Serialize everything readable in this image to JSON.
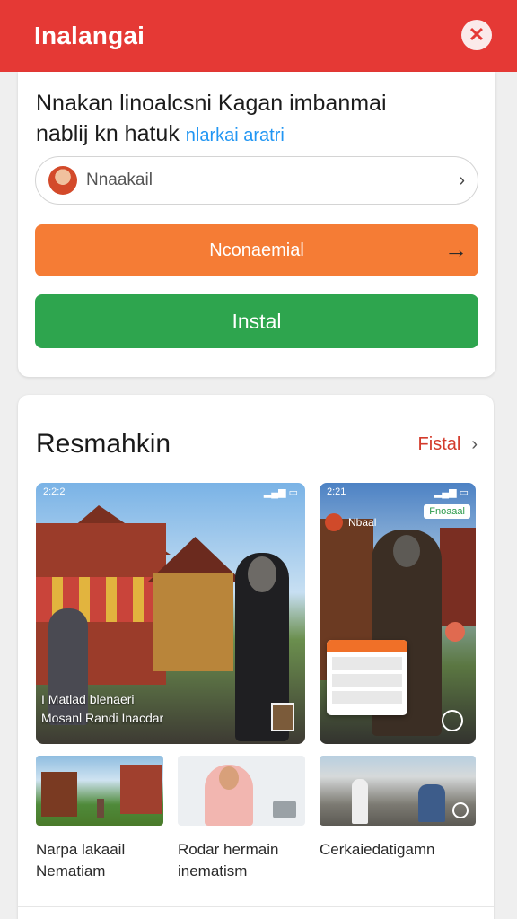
{
  "topbar": {
    "title": "Inalangai"
  },
  "intro": {
    "headline_line1": "Nnakan linoalcsni Kagan imbanmai",
    "headline_line2": "nablij kn hatuk",
    "headline_link": "nlarkai aratri"
  },
  "selector": {
    "label": "Nnaakail"
  },
  "buttons": {
    "primary_label": "Nconaemial",
    "install_label": "Instal"
  },
  "section": {
    "title": "Resmahkin",
    "see_all": "Fistal"
  },
  "screenshots": {
    "main": {
      "status_time": "2:2:2",
      "caption_line1": "I Matlad blenaeri",
      "caption_line2": "Mosanl Randi Inacdar"
    },
    "side": {
      "status_time": "2:21",
      "app_name": "Nbaal",
      "tag": "Fnoaaal"
    }
  },
  "thumbnails": [
    {
      "caption": "Narpa lakaail Nematiam"
    },
    {
      "caption": "Rodar hermain inematism"
    },
    {
      "caption": "Cerkaiedatigamn"
    }
  ],
  "colors": {
    "brand_red": "#e53935",
    "orange": "#f57c35",
    "green": "#2ea54e",
    "link_blue": "#2196f3"
  }
}
